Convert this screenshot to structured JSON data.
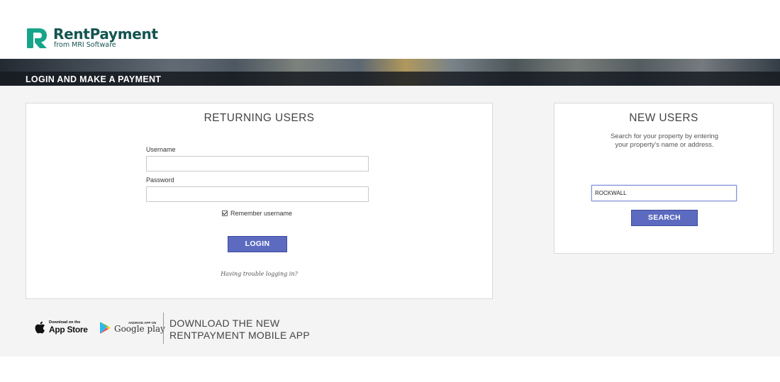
{
  "brand": {
    "name": "RentPayment",
    "subtitle": "from MRI Software",
    "color": "#14544f",
    "accent": "#17a58a"
  },
  "banner": {
    "title": "LOGIN AND MAKE A PAYMENT"
  },
  "returning_users": {
    "heading": "RETURNING USERS",
    "username_label": "Username",
    "username_value": "",
    "password_label": "Password",
    "password_value": "",
    "remember_label": "Remember username",
    "remember_checked": true,
    "login_button": "LOGIN",
    "trouble_link": "Having trouble logging in?"
  },
  "new_users": {
    "heading": "NEW USERS",
    "description": "Search for your property by entering your property's name or address.",
    "search_value": "ROCKWALL",
    "search_button": "SEARCH"
  },
  "apps": {
    "app_store_small": "Download on the",
    "app_store_big": "App Store",
    "google_play_small": "ANDROID APP ON",
    "google_play_big": "Google play",
    "promo_line1": "DOWNLOAD THE NEW",
    "promo_line2": "RENTPAYMENT MOBILE APP"
  },
  "colors": {
    "button": "#5c6bc0",
    "panel_border": "#d9d9d9",
    "main_background": "#f4f4f4"
  }
}
